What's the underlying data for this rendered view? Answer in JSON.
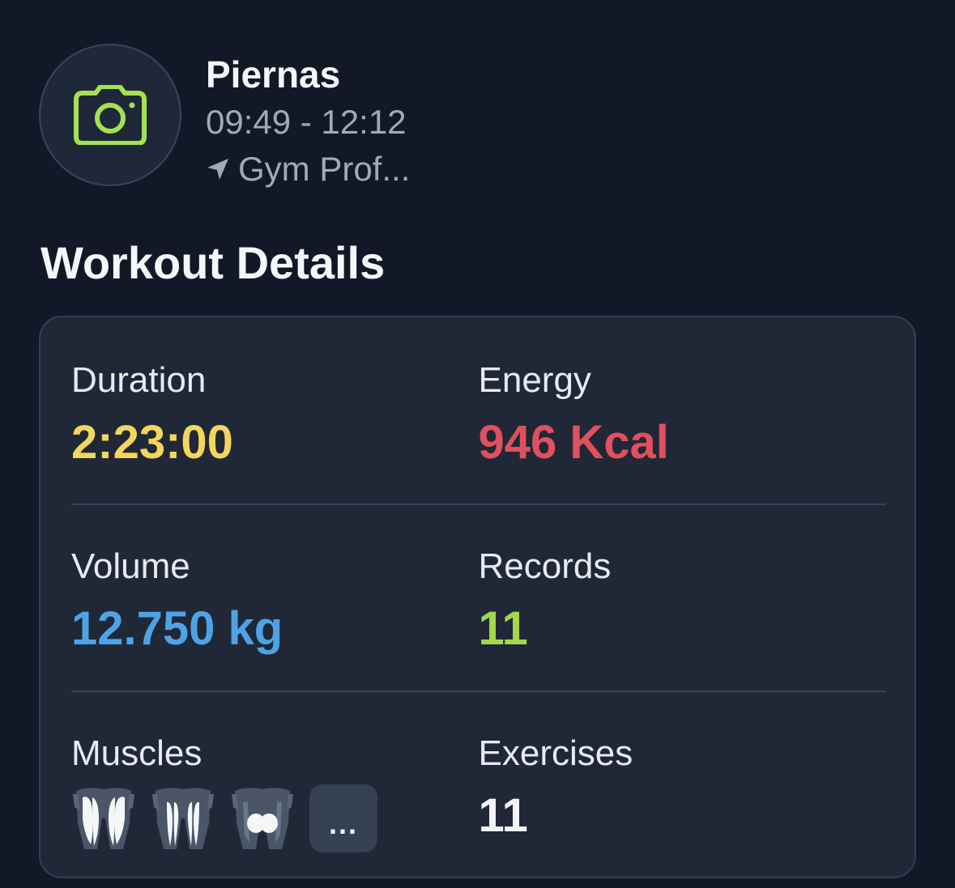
{
  "workout": {
    "title": "Piernas",
    "time_range": "09:49 - 12:12",
    "location": "Gym Prof...",
    "icons": {
      "avatar": "camera-icon",
      "location": "location-arrow-icon"
    }
  },
  "details": {
    "section_title": "Workout Details",
    "duration": {
      "label": "Duration",
      "value": "2:23:00",
      "color": "#f3d65c"
    },
    "energy": {
      "label": "Energy",
      "value": "946 Kcal",
      "color": "#e0505f"
    },
    "volume": {
      "label": "Volume",
      "value": "12.750 kg",
      "color": "#4ea3e6"
    },
    "records": {
      "label": "Records",
      "value": "11",
      "color": "#a3d84c"
    },
    "muscles": {
      "label": "Muscles",
      "icons": [
        "quadriceps-icon",
        "hamstrings-icon",
        "glutes-icon"
      ],
      "more_label": "..."
    },
    "exercises": {
      "label": "Exercises",
      "value": "11",
      "color": "#f2f4f8"
    }
  },
  "colors": {
    "background": "#121828",
    "card": "#202837",
    "accent_camera": "#a7e04f"
  }
}
